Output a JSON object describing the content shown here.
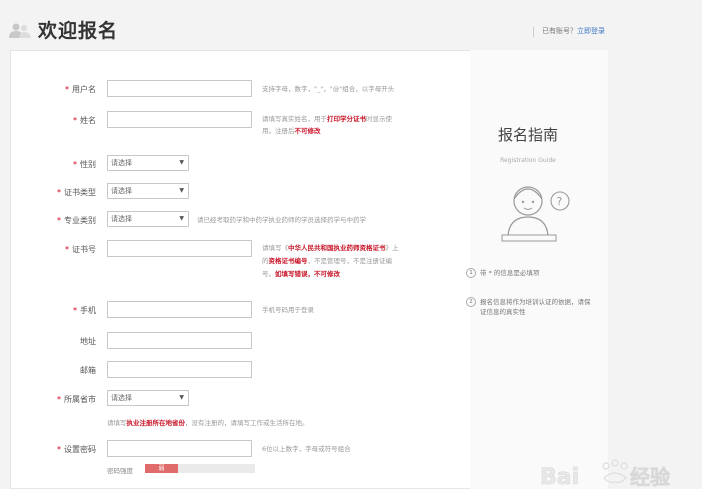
{
  "header": {
    "title": "欢迎报名",
    "has_account": "已有账号？",
    "login_link": "立即登录"
  },
  "form": {
    "username": {
      "label": "用户名",
      "hint": "支持字母，数字，\"_\"，\"@\"组合，以字母开头"
    },
    "name": {
      "label": "姓名",
      "hint_a": "请填写真实姓名，用于",
      "hint_b": "打印学分证书",
      "hint_c": "时显示使",
      "hint_d": "用。注册后",
      "hint_e": "不可修改"
    },
    "gender": {
      "label": "性别",
      "value": "请选择"
    },
    "cert_type": {
      "label": "证书类型",
      "value": "请选择"
    },
    "specialty": {
      "label": "专业类别",
      "value": "请选择",
      "hint": "请已经考取药学和中药学执业药师的学员选择药学与中药学"
    },
    "cert_no": {
      "label": "证书号",
      "hint_a": "请填写《",
      "hint_b": "中华人民共和国执业药师资格证书",
      "hint_c": "》上",
      "hint_d": "的",
      "hint_e": "资格证书编号",
      "hint_f": "，不是管理号，不是注册证编",
      "hint_g": "号。",
      "hint_h": "如填写错误，不可修改"
    },
    "phone": {
      "label": "手机",
      "hint": "手机号码用于登录"
    },
    "address": {
      "label": "地址"
    },
    "email": {
      "label": "邮箱"
    },
    "province": {
      "label": "所属省市",
      "value": "请选择",
      "hint_a": "请填写",
      "hint_b": "执业注册所在地省份",
      "hint_c": "，没有注册的，请填写工作或生活所在地。"
    },
    "password": {
      "label": "设置密码",
      "hint": "6位以上数字，字母或符号组合",
      "strength_label": "密码强度",
      "strength_value": "弱",
      "strength": 0.3
    }
  },
  "guide": {
    "title": "报名指南",
    "subtitle": "Registration Guide",
    "items": [
      {
        "num": "1",
        "text": "带 * 的信息是必填项"
      },
      {
        "num": "2",
        "text": "报名信息将作为培训认证的依据，请保证信息的真实性"
      }
    ]
  },
  "watermark": "Bai经验",
  "colors": {
    "required": "#d0001b",
    "link": "#3a75c4",
    "strength_fill": "#e06b6b"
  }
}
